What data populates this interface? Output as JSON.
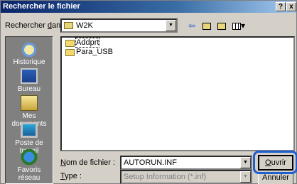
{
  "window": {
    "title": "Rechercher le fichier",
    "help_button": "?",
    "close_button": "x"
  },
  "lookin": {
    "label_prefix": "Rechercher ",
    "label_accel": "d",
    "label_suffix": "ans :",
    "value": "W2K"
  },
  "places": [
    {
      "label": "Historique",
      "icon": "history-icon"
    },
    {
      "label": "Bureau",
      "icon": "desktop-icon"
    },
    {
      "label": "Mes documents",
      "icon": "my-documents-icon"
    },
    {
      "label": "Poste de travail",
      "icon": "my-computer-icon"
    },
    {
      "label": "Favoris réseau",
      "icon": "network-places-icon"
    }
  ],
  "files": [
    {
      "name": "Addprt",
      "selected": true
    },
    {
      "name": "Para_USB",
      "selected": false
    }
  ],
  "filename": {
    "label_accel": "N",
    "label_rest": "om de fichier :",
    "value": "AUTORUN.INF"
  },
  "filetype": {
    "label_accel": "T",
    "label_rest": "ype :",
    "value": "Setup Information (*.inf)"
  },
  "buttons": {
    "open_accel": "O",
    "open_rest": "uvrir",
    "cancel": "Annuler"
  },
  "colors": {
    "titlebar_start": "#0a246a",
    "highlight_ring": "#1f5fd0"
  }
}
